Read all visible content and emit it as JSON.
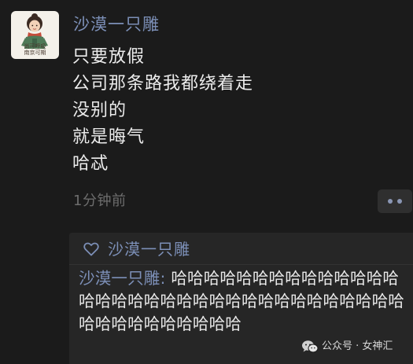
{
  "post": {
    "avatar": {
      "icon": "cartoon-girl-avatar",
      "caption_line1": "尚可呼吸",
      "caption_line2": "南京可期"
    },
    "author": "沙漠一只雕",
    "lines": [
      "只要放假",
      "公司那条路我都绕着走",
      "没别的",
      "就是晦气",
      "哈忒"
    ],
    "time": "1分钟前",
    "more_icon": "more-dots-icon"
  },
  "interactions": {
    "like_icon": "heart-outline-icon",
    "likers": "沙漠一只雕",
    "comments": [
      {
        "author": "沙漠一只雕",
        "separator": ": ",
        "text": "哈哈哈哈哈哈哈哈哈哈哈哈哈哈哈哈哈哈哈哈哈哈哈哈哈哈哈哈哈哈哈哈哈哈哈哈哈哈哈哈哈哈哈哈"
      }
    ]
  },
  "watermark": {
    "icon": "wechat-official-account-icon",
    "text": "公众号 · 女神汇"
  },
  "colors": {
    "background": "#1b1b1b",
    "panel": "#262626",
    "name_blue": "#7c8fb7",
    "text": "#ececec",
    "muted": "#6d6d6d"
  }
}
